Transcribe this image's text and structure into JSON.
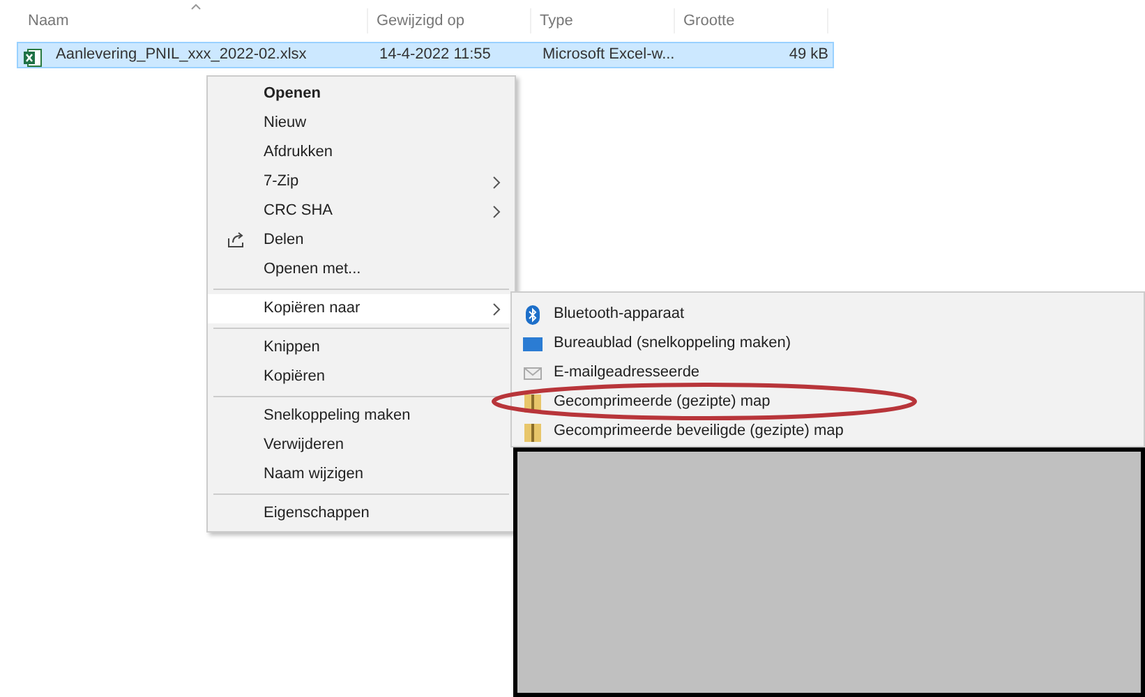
{
  "columns": [
    {
      "label": "Naam"
    },
    {
      "label": "Gewijzigd op"
    },
    {
      "label": "Type"
    },
    {
      "label": "Grootte"
    }
  ],
  "files": [
    {
      "name": "Aanlevering_PNIL_xxx_2022-02.xlsx",
      "modified": "14-4-2022 11:55",
      "type": "Microsoft Excel-w...",
      "size": "49 kB",
      "selected": true
    }
  ],
  "context_menu": {
    "items": [
      {
        "kind": "item",
        "label": "Openen",
        "default": true,
        "submenu": false,
        "icon": false,
        "selected": false
      },
      {
        "kind": "item",
        "label": "Nieuw",
        "default": false,
        "submenu": false,
        "icon": false,
        "selected": false
      },
      {
        "kind": "item",
        "label": "Afdrukken",
        "default": false,
        "submenu": false,
        "icon": false,
        "selected": false
      },
      {
        "kind": "item",
        "label": "7-Zip",
        "default": false,
        "submenu": true,
        "icon": false,
        "selected": false
      },
      {
        "kind": "item",
        "label": "CRC SHA",
        "default": false,
        "submenu": true,
        "icon": false,
        "selected": false
      },
      {
        "kind": "item",
        "label": "Delen",
        "default": false,
        "submenu": false,
        "icon": true,
        "selected": false
      },
      {
        "kind": "item",
        "label": "Openen met...",
        "default": false,
        "submenu": false,
        "icon": false,
        "selected": false
      },
      {
        "kind": "separator"
      },
      {
        "kind": "item",
        "label": "Kopiëren naar",
        "default": false,
        "submenu": true,
        "icon": false,
        "selected": true
      },
      {
        "kind": "separator"
      },
      {
        "kind": "item",
        "label": "Knippen",
        "default": false,
        "submenu": false,
        "icon": false,
        "selected": false
      },
      {
        "kind": "item",
        "label": "Kopiëren",
        "default": false,
        "submenu": false,
        "icon": false,
        "selected": false
      },
      {
        "kind": "separator"
      },
      {
        "kind": "item",
        "label": "Snelkoppeling maken",
        "default": false,
        "submenu": false,
        "icon": false,
        "selected": false
      },
      {
        "kind": "item",
        "label": "Verwijderen",
        "default": false,
        "submenu": false,
        "icon": false,
        "selected": false
      },
      {
        "kind": "item",
        "label": "Naam wijzigen",
        "default": false,
        "submenu": false,
        "icon": false,
        "selected": false
      },
      {
        "kind": "separator"
      },
      {
        "kind": "item",
        "label": "Eigenschappen",
        "default": false,
        "submenu": false,
        "icon": false,
        "selected": false
      }
    ]
  },
  "submenu": {
    "items": [
      {
        "kind": "bluetooth",
        "label": "Bluetooth-apparaat"
      },
      {
        "kind": "desktop",
        "label": "Bureaublad (snelkoppeling maken)"
      },
      {
        "kind": "mail",
        "label": "E-mailgeadresseerde"
      },
      {
        "kind": "zip",
        "label": "Gecomprimeerde (gezipte) map"
      },
      {
        "kind": "zip",
        "label": "Gecomprimeerde beveiligde (gezipte) map"
      }
    ]
  },
  "annotation_ellipse": true,
  "redaction_box": true
}
